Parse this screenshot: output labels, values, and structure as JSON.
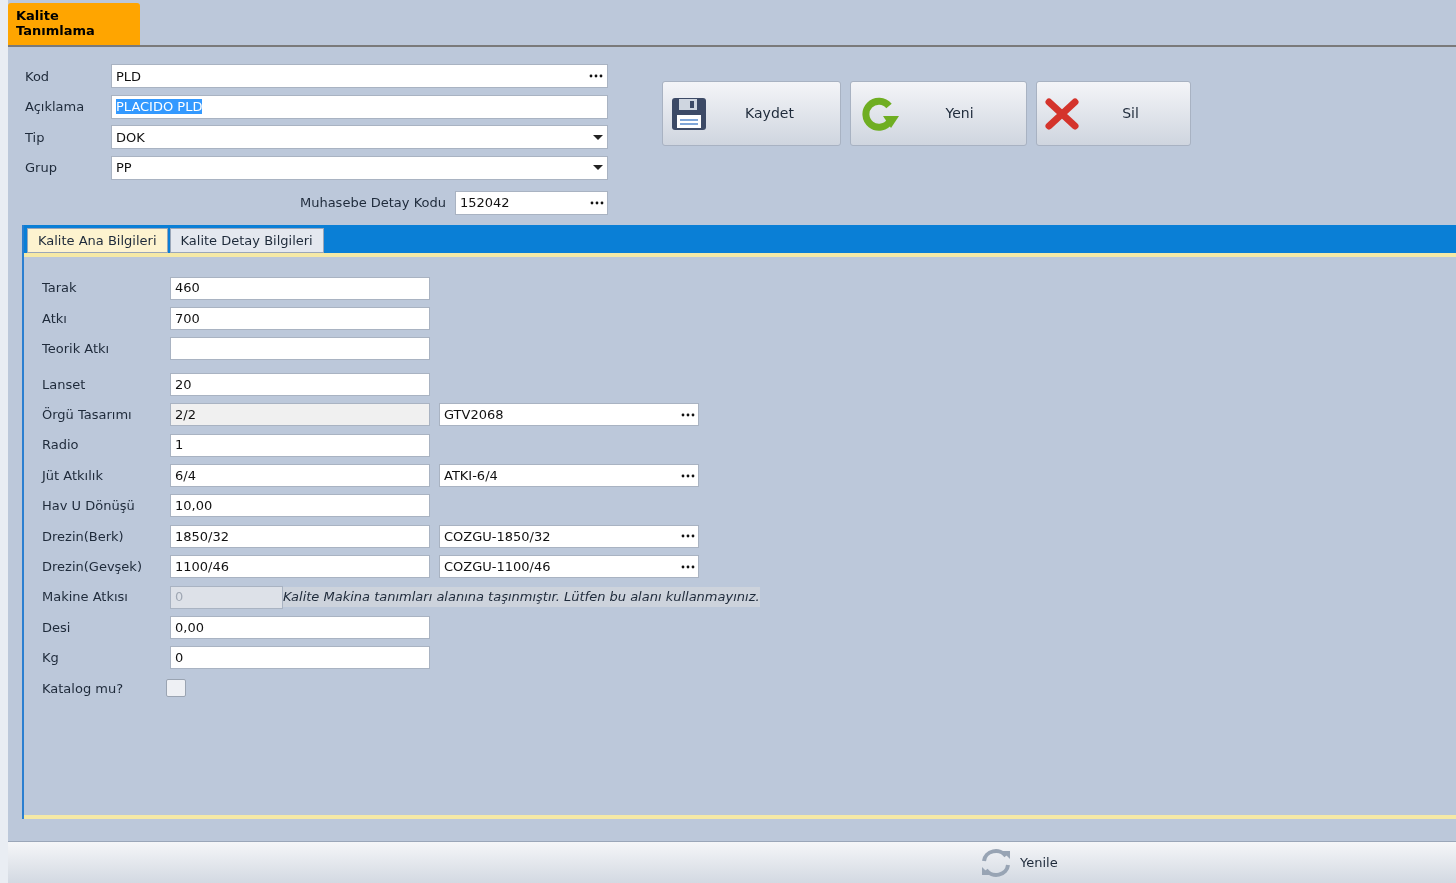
{
  "header_tab": {
    "title": "Kalite Tanımlama",
    "selected": true
  },
  "top_fields": [
    {
      "label": "Kod",
      "value": "PLD",
      "kind": "lookup",
      "highlighted": false
    },
    {
      "label": "Açıklama",
      "value": "PLACIDO PLD",
      "kind": "text",
      "highlighted": true
    },
    {
      "label": "Tip",
      "value": "DOK",
      "kind": "dropdown",
      "highlighted": false
    },
    {
      "label": "Grup",
      "value": "PP",
      "kind": "dropdown",
      "highlighted": false
    }
  ],
  "accounting_field": {
    "label": "Muhasebe Detay Kodu",
    "value": "152042"
  },
  "actions": [
    {
      "label": "Kaydet",
      "kind": "save"
    },
    {
      "label": "Yeni",
      "kind": "new"
    },
    {
      "label": "Sil",
      "kind": "delete"
    }
  ],
  "tabs": [
    {
      "label": "Kalite Ana Bilgileri",
      "selected": true
    },
    {
      "label": "Kalite Detay Bilgileri",
      "selected": false
    }
  ],
  "rows": [
    {
      "label": "Tarak",
      "kind": "text",
      "value": "460",
      "readonly": false
    },
    {
      "label": "Atkı",
      "kind": "text",
      "value": "700",
      "readonly": false
    },
    {
      "label": "Teorik Atkı",
      "kind": "text",
      "readonly": false
    },
    {
      "label": "Lanset",
      "kind": "text",
      "value": "20",
      "readonly": false
    },
    {
      "label": "Örgü Tasarımı",
      "kind": "lookup",
      "value": "2/2",
      "readonly": true,
      "lookup": "GTV2068"
    },
    {
      "label": "Radio",
      "kind": "text",
      "value": "1",
      "readonly": false
    },
    {
      "label": "Jüt Atkılık",
      "kind": "lookup",
      "value": "6/4",
      "readonly": false,
      "lookup": "ATKI-6/4"
    },
    {
      "label": "Hav U Dönüşü",
      "kind": "text",
      "value": "10,00",
      "readonly": false
    },
    {
      "label": "Drezin(Berk)",
      "kind": "lookup",
      "value": "1850/32",
      "readonly": false,
      "lookup": "COZGU-1850/32"
    },
    {
      "label": "Drezin(Gevşek)",
      "kind": "lookup",
      "value": "1100/46",
      "readonly": false,
      "lookup": "COZGU-1100/46"
    },
    {
      "label": "Makine Atkısı",
      "kind": "disabled",
      "value": "0",
      "note": "Kalite Makina tanımları alanına taşınmıştır. Lütfen bu alanı kullanmayınız."
    },
    {
      "label": "Desi",
      "kind": "text",
      "value": "0,00",
      "readonly": false
    },
    {
      "label": "Kg",
      "kind": "text",
      "value": "0",
      "readonly": false
    },
    {
      "label": "Katalog mu?",
      "kind": "checkbox",
      "checked": false
    }
  ],
  "footer_button": {
    "label": "Yenile"
  }
}
